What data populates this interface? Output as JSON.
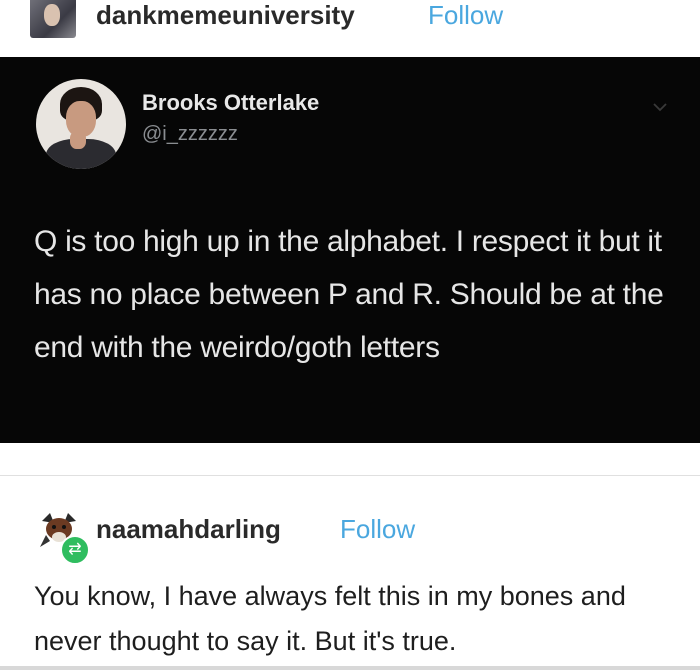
{
  "post": {
    "username": "dankmemeuniversity",
    "follow_label": "Follow"
  },
  "tweet": {
    "display_name": "Brooks Otterlake",
    "handle": "@i_zzzzzz",
    "text": "Q is too high up in the alphabet. I respect it but it has no place between P and R. Should be at the end with the weirdo/goth letters"
  },
  "reblog": {
    "username": "naamahdarling",
    "follow_label": "Follow",
    "text": "You know, I have always felt this in my bones and never thought to say it. But it's true."
  },
  "icons": {
    "reblog_badge": "reblog-icon",
    "tweet_menu": "chevron-down-icon"
  },
  "colors": {
    "follow_link": "#4aa7df",
    "tweet_background": "#060606",
    "reblog_badge": "#2fbd5f"
  }
}
